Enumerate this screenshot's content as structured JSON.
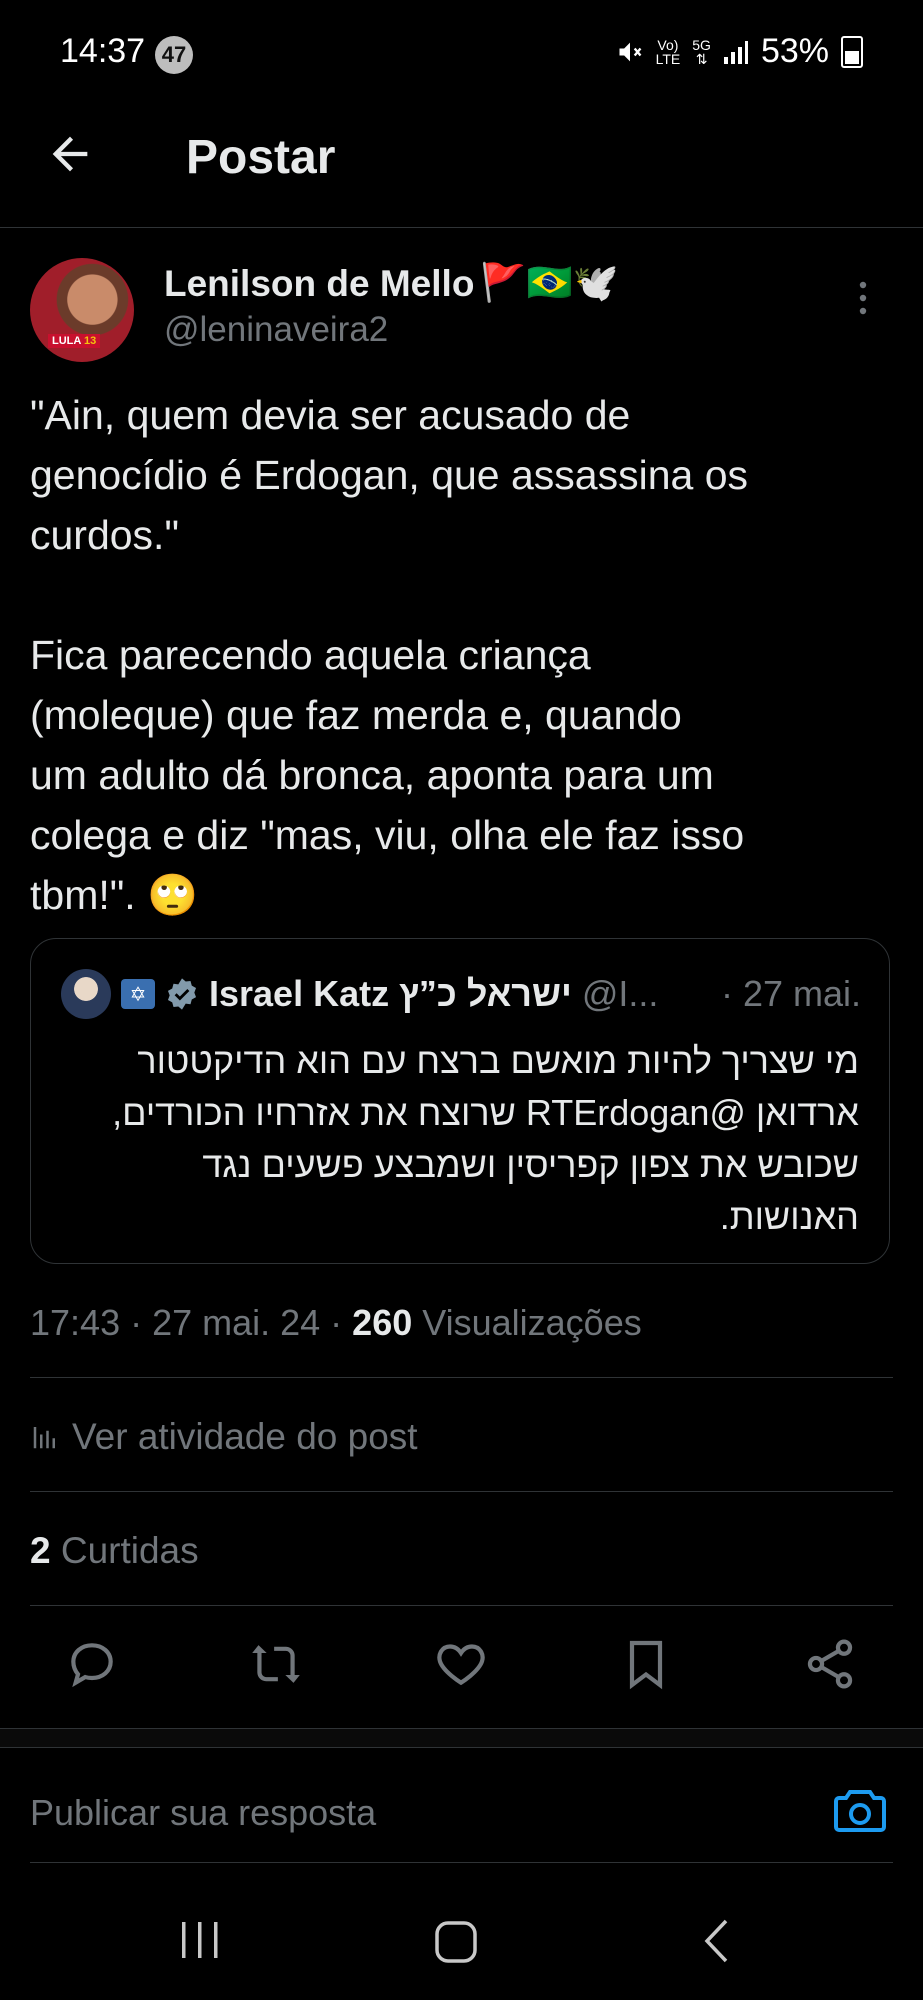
{
  "status_bar": {
    "time": "14:37",
    "notif_count": "47",
    "battery": "53%",
    "lte_label": "LTE",
    "volte_label": "Vo)",
    "net_label": "5G"
  },
  "header": {
    "title": "Postar"
  },
  "author": {
    "name": "Lenilson de Mello",
    "emojis": "🚩🇧🇷🕊️",
    "handle": "@leninaveira2",
    "avatar_tag_text": "LULA",
    "avatar_tag_num": "13"
  },
  "tweet": {
    "text": "\"Ain, quem devia ser acusado de\ngenocídio é Erdogan, que assassina os\ncurdos.\"\n\nFica parecendo aquela criança\n(moleque) que faz merda e, quando\num adulto dá bronca, aponta para um\ncolega e diz \"mas, viu, olha ele faz isso\ntbm!\". 🙄"
  },
  "quote": {
    "name": "Israel Katz ישראל כ”ץ",
    "handle": "@I...",
    "date": "· 27 mai.",
    "text": "מי שצריך להיות מואשם ברצח עם הוא הדיקטטור ארדואן @RTErdogan שרוצח את אזרחיו הכורדים, שכובש את צפון קפריסין ושמבצע פשעים נגד האנושות."
  },
  "meta": {
    "timestamp": "17:43 · 27 mai. 24 · ",
    "views_count": "260",
    "views_label": " Visualizações"
  },
  "activity_label": "Ver atividade do post",
  "likes": {
    "count": "2",
    "label": " Curtidas"
  },
  "reply_placeholder": "Publicar sua resposta",
  "colors": {
    "background": "#000000",
    "text": "#e7e9ea",
    "muted": "#71767b",
    "divider": "#2f3336",
    "accent": "#1d9bf0"
  },
  "icons": [
    "back-arrow-icon",
    "more-options-icon",
    "verified-icon",
    "reply-icon",
    "repost-icon",
    "like-icon",
    "bookmark-icon",
    "share-icon",
    "camera-icon",
    "analytics-icon"
  ]
}
